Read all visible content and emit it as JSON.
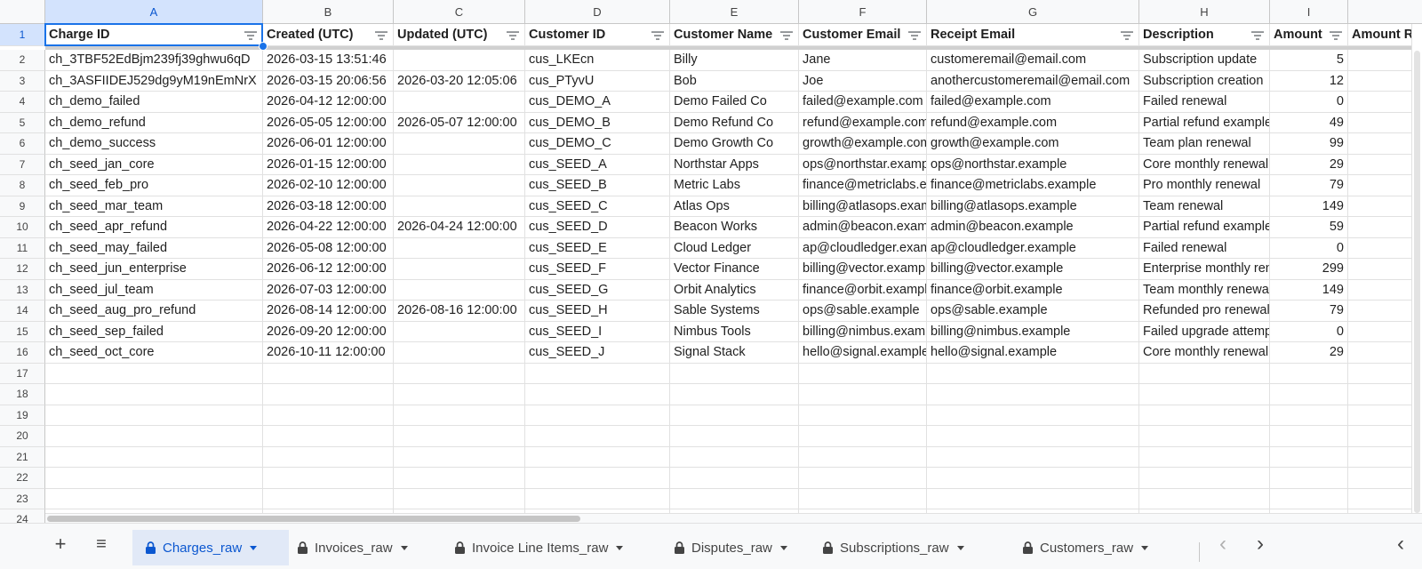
{
  "columns": [
    "A",
    "B",
    "C",
    "D",
    "E",
    "F",
    "G",
    "H",
    "I",
    ""
  ],
  "headers": [
    "Charge ID",
    "Created (UTC)",
    "Updated (UTC)",
    "Customer ID",
    "Customer Name",
    "Customer Email",
    "Receipt Email",
    "Description",
    "Amount",
    "Amount Re"
  ],
  "rows": [
    [
      "ch_3TBF52EdBjm239fj39ghwu6qD",
      "2026-03-15 13:51:46",
      "",
      "cus_LKEcn",
      "Billy",
      "Jane",
      "customeremail@email.com",
      "Subscription update",
      "5"
    ],
    [
      "ch_3ASFIIDEJ529dg9yM19nEmNrX",
      "2026-03-15 20:06:56",
      "2026-03-20 12:05:06",
      "cus_PTyvU",
      "Bob",
      "Joe",
      "anothercustomeremail@email.com",
      "Subscription creation",
      "12"
    ],
    [
      "ch_demo_failed",
      "2026-04-12 12:00:00",
      "",
      "cus_DEMO_A",
      "Demo Failed Co",
      "failed@example.com",
      "failed@example.com",
      "Failed renewal",
      "0"
    ],
    [
      "ch_demo_refund",
      "2026-05-05 12:00:00",
      "2026-05-07 12:00:00",
      "cus_DEMO_B",
      "Demo Refund Co",
      "refund@example.com",
      "refund@example.com",
      "Partial refund example",
      "49"
    ],
    [
      "ch_demo_success",
      "2026-06-01 12:00:00",
      "",
      "cus_DEMO_C",
      "Demo Growth Co",
      "growth@example.com",
      "growth@example.com",
      "Team plan renewal",
      "99"
    ],
    [
      "ch_seed_jan_core",
      "2026-01-15 12:00:00",
      "",
      "cus_SEED_A",
      "Northstar Apps",
      "ops@northstar.example",
      "ops@northstar.example",
      "Core monthly renewal",
      "29"
    ],
    [
      "ch_seed_feb_pro",
      "2026-02-10 12:00:00",
      "",
      "cus_SEED_B",
      "Metric Labs",
      "finance@metriclabs.example",
      "finance@metriclabs.example",
      "Pro monthly renewal",
      "79"
    ],
    [
      "ch_seed_mar_team",
      "2026-03-18 12:00:00",
      "",
      "cus_SEED_C",
      "Atlas Ops",
      "billing@atlasops.example",
      "billing@atlasops.example",
      "Team renewal",
      "149"
    ],
    [
      "ch_seed_apr_refund",
      "2026-04-22 12:00:00",
      "2026-04-24 12:00:00",
      "cus_SEED_D",
      "Beacon Works",
      "admin@beacon.example",
      "admin@beacon.example",
      "Partial refund example",
      "59"
    ],
    [
      "ch_seed_may_failed",
      "2026-05-08 12:00:00",
      "",
      "cus_SEED_E",
      "Cloud Ledger",
      "ap@cloudledger.example",
      "ap@cloudledger.example",
      "Failed renewal",
      "0"
    ],
    [
      "ch_seed_jun_enterprise",
      "2026-06-12 12:00:00",
      "",
      "cus_SEED_F",
      "Vector Finance",
      "billing@vector.example",
      "billing@vector.example",
      "Enterprise monthly renewal",
      "299"
    ],
    [
      "ch_seed_jul_team",
      "2026-07-03 12:00:00",
      "",
      "cus_SEED_G",
      "Orbit Analytics",
      "finance@orbit.example",
      "finance@orbit.example",
      "Team monthly renewal",
      "149"
    ],
    [
      "ch_seed_aug_pro_refund",
      "2026-08-14 12:00:00",
      "2026-08-16 12:00:00",
      "cus_SEED_H",
      "Sable Systems",
      "ops@sable.example",
      "ops@sable.example",
      "Refunded pro renewal",
      "79"
    ],
    [
      "ch_seed_sep_failed",
      "2026-09-20 12:00:00",
      "",
      "cus_SEED_I",
      "Nimbus Tools",
      "billing@nimbus.example",
      "billing@nimbus.example",
      "Failed upgrade attempt",
      "0"
    ],
    [
      "ch_seed_oct_core",
      "2026-10-11 12:00:00",
      "",
      "cus_SEED_J",
      "Signal Stack",
      "hello@signal.example",
      "hello@signal.example",
      "Core monthly renewal",
      "29"
    ]
  ],
  "row_numbers": [
    "1",
    "2",
    "3",
    "4",
    "5",
    "6",
    "7",
    "8",
    "9",
    "10",
    "11",
    "12",
    "13",
    "14",
    "15",
    "16",
    "17",
    "18",
    "19",
    "20",
    "21",
    "22",
    "23",
    "24"
  ],
  "tabs": [
    {
      "label": "Charges_raw",
      "active": true
    },
    {
      "label": "Invoices_raw",
      "active": false
    },
    {
      "label": "Invoice Line Items_raw",
      "active": false
    },
    {
      "label": "Disputes_raw",
      "active": false
    },
    {
      "label": "Subscriptions_raw",
      "active": false
    },
    {
      "label": "Customers_raw",
      "active": false
    }
  ],
  "toolbar": {
    "add_sheet": "+",
    "all_sheets": "≡",
    "prev": "‹",
    "next": "›",
    "collapse": "‹"
  },
  "colors": {
    "accent": "#0b57d0",
    "selection": "#1a73e8",
    "header_bg": "#f8f9fa"
  }
}
